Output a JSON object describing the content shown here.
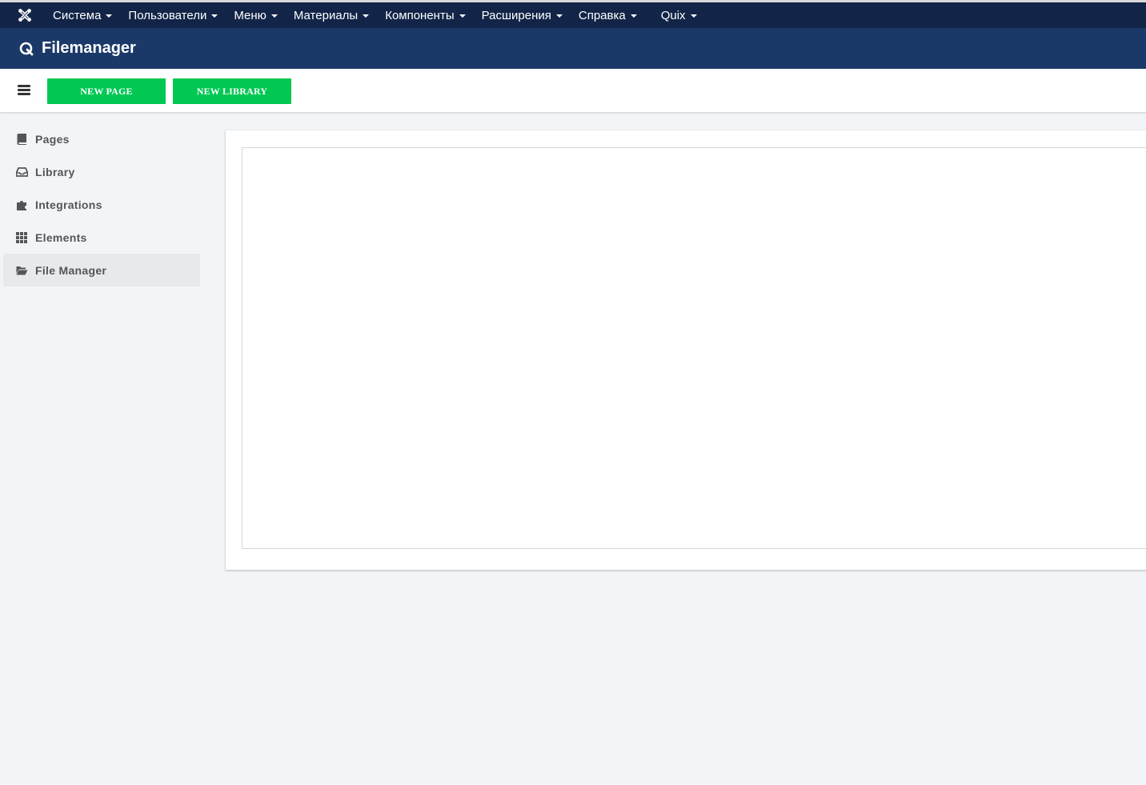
{
  "topbar": {
    "logo_icon": "joomla-icon",
    "menu": [
      {
        "label": "Система"
      },
      {
        "label": "Пользователи"
      },
      {
        "label": "Меню"
      },
      {
        "label": "Материалы"
      },
      {
        "label": "Компоненты"
      },
      {
        "label": "Расширения"
      },
      {
        "label": "Справка"
      },
      {
        "label": "Quix"
      }
    ]
  },
  "header": {
    "icon": "quix-icon",
    "title": "Filemanager"
  },
  "toolbar": {
    "menu_toggle_icon": "hamburger-icon",
    "new_page_label": "NEW PAGE",
    "new_library_label": "NEW LIBRARY"
  },
  "sidebar": {
    "items": [
      {
        "label": "Pages",
        "icon": "book-icon"
      },
      {
        "label": "Library",
        "icon": "inbox-icon"
      },
      {
        "label": "Integrations",
        "icon": "puzzle-icon"
      },
      {
        "label": "Elements",
        "icon": "grid-icon"
      },
      {
        "label": "File Manager",
        "icon": "folder-open-icon",
        "active": true
      }
    ]
  },
  "colors": {
    "topbar_bg": "#122548",
    "header_bg": "#1b3968",
    "button_bg": "#00c853",
    "page_bg": "#f2f5f8",
    "active_item_bg": "#e8e9eb"
  }
}
